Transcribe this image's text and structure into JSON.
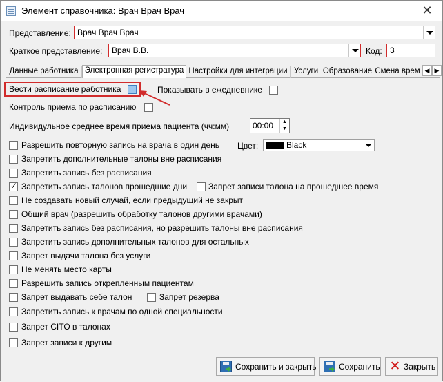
{
  "window": {
    "title": "Элемент справочника: Врач Врач Врач",
    "close": "✕"
  },
  "header": {
    "view_label": "Представление:",
    "view_value": "Врач Врач Врач",
    "short_label": "Краткое представление:",
    "short_value": "Врач В.В.",
    "code_label": "Код:",
    "code_value": "3"
  },
  "tabs": [
    {
      "label": "Данные работника"
    },
    {
      "label": "Электронная регистратура"
    },
    {
      "label": "Настройки для интеграции"
    },
    {
      "label": "Услуги"
    },
    {
      "label": "Образование"
    },
    {
      "label": "Смена врем"
    }
  ],
  "tab_scroll": {
    "left": "◀",
    "right": "▶"
  },
  "form": {
    "schedule_label": "Вести расписание работника",
    "schedule_checked": true,
    "show_diary_label": "Показывать в ежедневнике",
    "control_label": "Контроль приема по расписанию",
    "avg_time_label": "Индивидульное среднее время приема пациента (чч:мм)",
    "avg_time_value": "00:00",
    "color_label": "Цвет:",
    "color_value": "Black",
    "color_swatch": "#000000",
    "options": [
      {
        "label": "Разрешить повторную запись на врача в один день",
        "checked": false
      },
      {
        "label": "Запретить дополнительные талоны вне расписания",
        "checked": false
      },
      {
        "label": "Запретить запись без расписания",
        "checked": false
      },
      {
        "label": "Запретить запись талонов прошедшие дни",
        "checked": true
      },
      {
        "label": "Не создавать новый случай, если предыдущий не закрыт",
        "checked": false
      },
      {
        "label": "Общий врач (разрешить обработку талонов другими врачами)",
        "checked": false
      },
      {
        "label": "Запретить запись без расписания, но разрешить талоны вне расписания",
        "checked": false
      },
      {
        "label": "Запретить запись дополнительных талонов для остальных",
        "checked": false
      },
      {
        "label": "Запрет выдачи талона без услуги",
        "checked": false
      },
      {
        "label": "Не менять место карты",
        "checked": false
      },
      {
        "label": "Разрешить запись открепленным пациентам",
        "checked": false
      },
      {
        "label": "Запрет выдавать себе талон",
        "checked": false
      },
      {
        "label": "Запретить запись к врачам по одной специальности",
        "checked": false
      },
      {
        "label": "Запрет CITO в талонах",
        "checked": false
      },
      {
        "label": "Запрет записи к другим",
        "checked": false
      }
    ],
    "past_time_label": "Запрет записи талона на прошедшее время",
    "reserve_label": "Запрет резерва"
  },
  "buttons": {
    "save_close": "Сохранить и закрыть",
    "save": "Сохранить",
    "close": "Закрыть"
  },
  "colors": {
    "highlight": "#d12c2c",
    "checkbox_blue": "#9dc8ef"
  }
}
